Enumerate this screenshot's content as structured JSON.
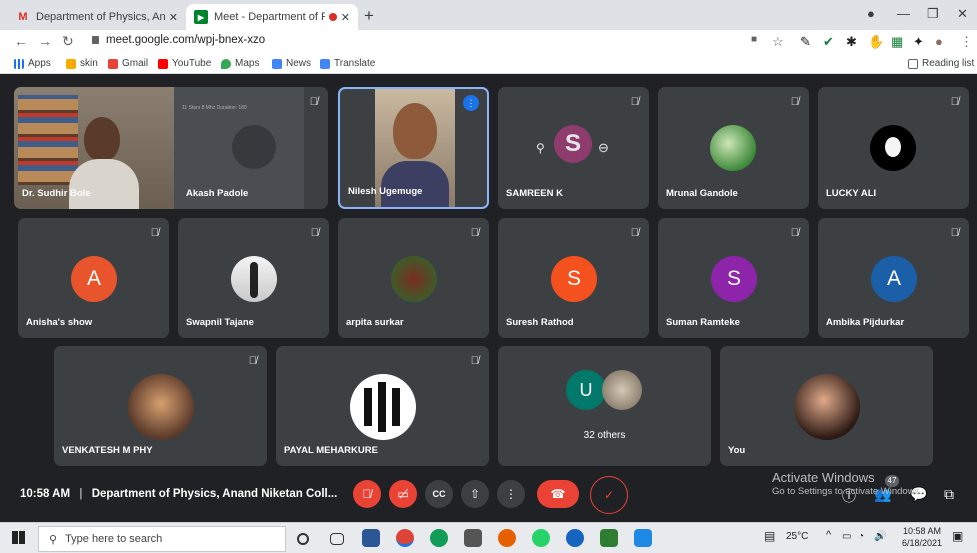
{
  "browser": {
    "tabs": [
      {
        "title": "Department of Physics, Anand N",
        "active": false
      },
      {
        "title": "Meet - Department of Physic",
        "active": true
      }
    ],
    "url": "meet.google.com/wpj-bnex-xzo",
    "bookmarks": [
      "Apps",
      "skin",
      "Gmail",
      "YouTube",
      "Maps",
      "News",
      "Translate"
    ],
    "reading_list": "Reading list"
  },
  "participants_row1": [
    {
      "name": "Dr. Sudhir Bole"
    },
    {
      "name": "Akash Padole"
    },
    {
      "name": "Nilesh Ugemuge"
    },
    {
      "name": "SAMREEN K",
      "initial": "S",
      "color": "#8e3b6e"
    },
    {
      "name": "Mrunal Gandole"
    },
    {
      "name": "LUCKY ALI"
    }
  ],
  "participants_row2": [
    {
      "name": "Anisha's show",
      "initial": "A",
      "color": "#e8552c"
    },
    {
      "name": "Swapnil Tajane"
    },
    {
      "name": "arpita surkar"
    },
    {
      "name": "Suresh Rathod",
      "initial": "S",
      "color": "#f4511e"
    },
    {
      "name": "Suman Ramteke",
      "initial": "S",
      "color": "#8e24aa"
    },
    {
      "name": "Ambika Pijdurkar",
      "initial": "A",
      "color": "#1a5fa8"
    }
  ],
  "participants_row3": [
    {
      "name": "VENKATESH M PHY"
    },
    {
      "name": "PAYAL MEHARKURE"
    },
    {
      "name": "32 others",
      "initial": "U",
      "color": "#00796b"
    },
    {
      "name": "You"
    }
  ],
  "screen_share_overlay": "11 Stars 8 Mhz Duration: 180",
  "meeting": {
    "time": "10:58 AM",
    "title": "Department of Physics, Anand Niketan Coll...",
    "participant_count": "47"
  },
  "activate_windows": {
    "line1": "Activate Windows",
    "line2": "Go to Settings to activate Windows."
  },
  "taskbar": {
    "search_placeholder": "Type here to search",
    "weather": "25°C",
    "clock_time": "10:58 AM",
    "clock_date": "6/18/2021"
  },
  "colors": {
    "accent_blue": "#8ab4f8",
    "end_call_red": "#ea4335",
    "tile_bg": "#3c4043",
    "meet_bg": "#202124"
  }
}
